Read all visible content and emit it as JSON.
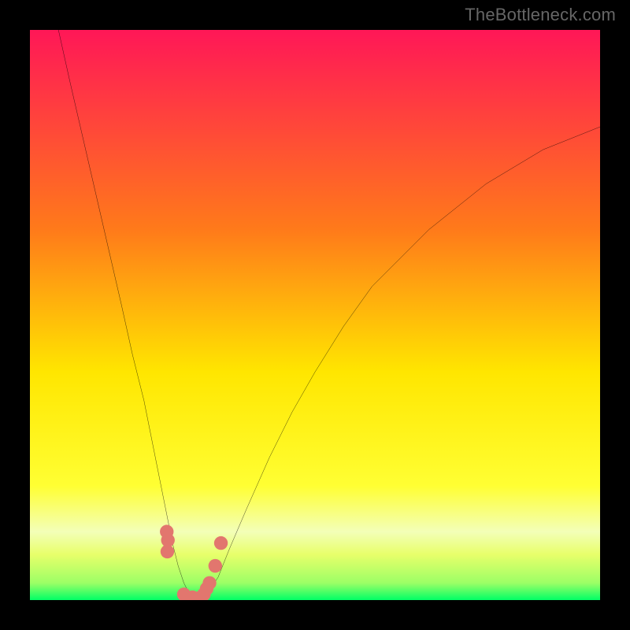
{
  "watermark": "TheBottleneck.com",
  "colors": {
    "frame": "#000000",
    "curve": "#000000",
    "scatter": "#e2766e",
    "gradient_top": "#ff1757",
    "gradient_upper_mid": "#ff7a1a",
    "gradient_mid": "#ffe600",
    "gradient_lower_mid": "#e8ff6a",
    "gradient_band_pale": "#f3ffb8",
    "gradient_bottom": "#00ff66"
  },
  "chart_data": {
    "type": "line",
    "title": "",
    "xlabel": "",
    "ylabel": "",
    "xlim": [
      0,
      100
    ],
    "ylim": [
      0,
      100
    ],
    "grid": false,
    "series": [
      {
        "name": "bottleneck-curve",
        "x": [
          5,
          7,
          10,
          13,
          16,
          18,
          20,
          22,
          24,
          25,
          26,
          27,
          28,
          29,
          30,
          31,
          33,
          35,
          38,
          42,
          46,
          50,
          55,
          60,
          65,
          70,
          75,
          80,
          85,
          90,
          95,
          100
        ],
        "y": [
          100,
          91,
          78,
          65,
          52,
          43,
          35,
          25,
          15,
          10,
          6,
          3,
          1,
          0,
          0,
          1,
          4,
          9,
          16,
          25,
          33,
          40,
          48,
          55,
          60,
          65,
          69,
          73,
          76,
          79,
          81,
          83
        ]
      }
    ],
    "scatter_points": {
      "name": "highlighted-points",
      "x": [
        24.0,
        24.2,
        24.1,
        27.0,
        28.5,
        30.0,
        30.5,
        31.0,
        31.5,
        32.5,
        33.5
      ],
      "y": [
        12.0,
        10.5,
        8.5,
        1.0,
        0.5,
        0.5,
        1.0,
        2.0,
        3.0,
        6.0,
        10.0
      ]
    },
    "background": {
      "type": "vertical-gradient",
      "stops": [
        {
          "pos": 0.0,
          "color": "#ff1757"
        },
        {
          "pos": 0.35,
          "color": "#ff7a1a"
        },
        {
          "pos": 0.6,
          "color": "#ffe600"
        },
        {
          "pos": 0.8,
          "color": "#ffff33"
        },
        {
          "pos": 0.88,
          "color": "#f3ffb8"
        },
        {
          "pos": 0.92,
          "color": "#e8ff6a"
        },
        {
          "pos": 0.97,
          "color": "#9cff66"
        },
        {
          "pos": 1.0,
          "color": "#00ff66"
        }
      ]
    }
  }
}
